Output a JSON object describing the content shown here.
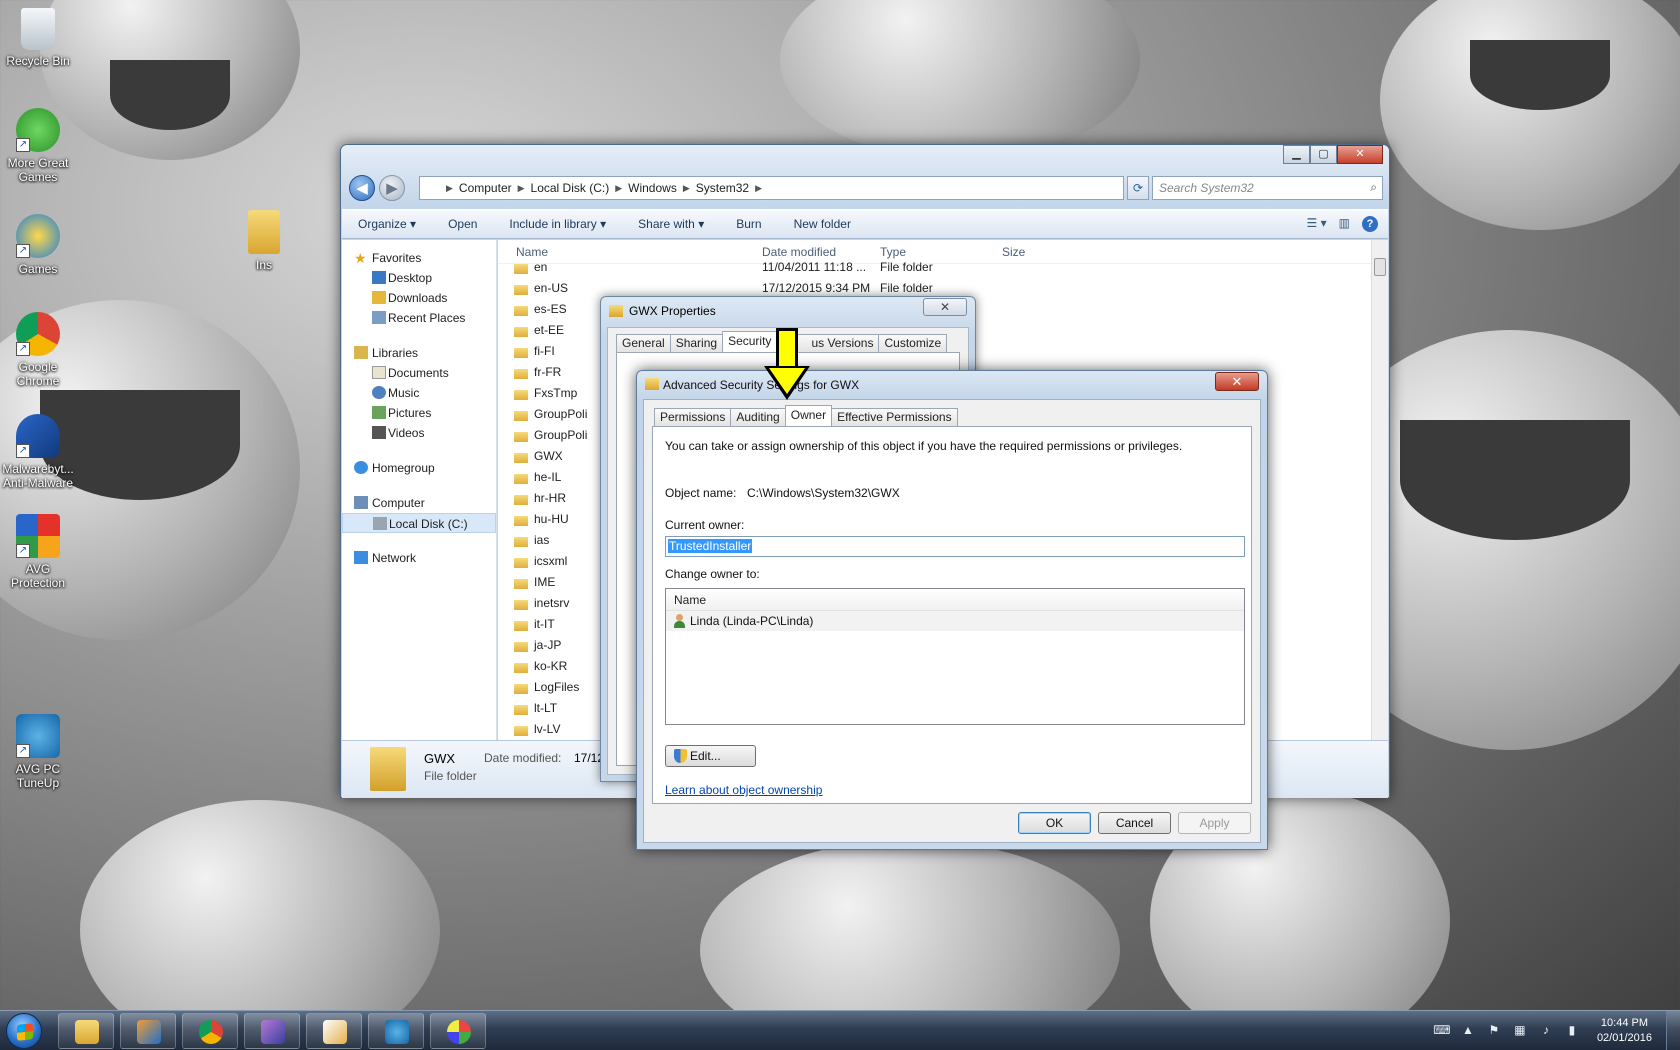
{
  "desktop": {
    "icons": [
      {
        "label": "Recycle Bin"
      },
      {
        "label": "More Great Games"
      },
      {
        "label": "Games"
      },
      {
        "label": "Google Chrome"
      },
      {
        "label": "Malwarebyt... Anti-Malware"
      },
      {
        "label": "AVG Protection"
      },
      {
        "label": "AVG PC TuneUp"
      },
      {
        "label": "Ins"
      }
    ]
  },
  "explorer": {
    "breadcrumb": [
      "Computer",
      "Local Disk (C:)",
      "Windows",
      "System32"
    ],
    "search_placeholder": "Search System32",
    "toolbar": {
      "organize": "Organize",
      "open": "Open",
      "include": "Include in library",
      "share": "Share with",
      "burn": "Burn",
      "new_folder": "New folder"
    },
    "nav": {
      "favorites": "Favorites",
      "desktop": "Desktop",
      "downloads": "Downloads",
      "recent": "Recent Places",
      "libraries": "Libraries",
      "documents": "Documents",
      "music": "Music",
      "pictures": "Pictures",
      "videos": "Videos",
      "homegroup": "Homegroup",
      "computer": "Computer",
      "local_disk": "Local Disk (C:)",
      "network": "Network"
    },
    "columns": {
      "name": "Name",
      "date": "Date modified",
      "type": "Type",
      "size": "Size"
    },
    "rows": [
      {
        "name": "en",
        "date": "11/04/2011 11:18 ...",
        "type": "File folder"
      },
      {
        "name": "en-US",
        "date": "17/12/2015 9:34 PM",
        "type": "File folder"
      },
      {
        "name": "es-ES",
        "date": "",
        "type": ""
      },
      {
        "name": "et-EE",
        "date": "",
        "type": ""
      },
      {
        "name": "fi-FI",
        "date": "",
        "type": ""
      },
      {
        "name": "fr-FR",
        "date": "",
        "type": ""
      },
      {
        "name": "FxsTmp",
        "date": "",
        "type": ""
      },
      {
        "name": "GroupPoli",
        "date": "",
        "type": ""
      },
      {
        "name": "GroupPoli",
        "date": "",
        "type": ""
      },
      {
        "name": "GWX",
        "date": "",
        "type": ""
      },
      {
        "name": "he-IL",
        "date": "",
        "type": ""
      },
      {
        "name": "hr-HR",
        "date": "",
        "type": ""
      },
      {
        "name": "hu-HU",
        "date": "",
        "type": ""
      },
      {
        "name": "ias",
        "date": "",
        "type": ""
      },
      {
        "name": "icsxml",
        "date": "",
        "type": ""
      },
      {
        "name": "IME",
        "date": "",
        "type": ""
      },
      {
        "name": "inetsrv",
        "date": "",
        "type": ""
      },
      {
        "name": "it-IT",
        "date": "",
        "type": ""
      },
      {
        "name": "ja-JP",
        "date": "",
        "type": ""
      },
      {
        "name": "ko-KR",
        "date": "",
        "type": ""
      },
      {
        "name": "LogFiles",
        "date": "",
        "type": ""
      },
      {
        "name": "lt-LT",
        "date": "",
        "type": ""
      },
      {
        "name": "lv-LV",
        "date": "",
        "type": ""
      }
    ],
    "details": {
      "name": "GWX",
      "type": "File folder",
      "date_label": "Date modified:",
      "date_value": "17/12/"
    }
  },
  "props": {
    "title": "GWX Properties",
    "close": "✕",
    "tabs": [
      "General",
      "Sharing",
      "Security",
      "us Versions",
      "Customize"
    ]
  },
  "adv": {
    "title": "Advanced Security Settings for GWX",
    "close": "✕",
    "tabs": [
      "Permissions",
      "Auditing",
      "Owner",
      "Effective Permissions"
    ],
    "intro": "You can take or assign ownership of this object if you have the required permissions or privileges.",
    "object_label": "Object name:",
    "object_value": "C:\\Windows\\System32\\GWX",
    "current_owner_label": "Current owner:",
    "current_owner_value": "TrustedInstaller",
    "change_owner_label": "Change owner to:",
    "list_header": "Name",
    "list_items": [
      "Linda (Linda-PC\\Linda)"
    ],
    "edit": "Edit...",
    "learn": "Learn about object ownership",
    "ok": "OK",
    "cancel": "Cancel",
    "apply": "Apply"
  },
  "taskbar": {
    "time": "10:44 PM",
    "date": "02/01/2016"
  }
}
